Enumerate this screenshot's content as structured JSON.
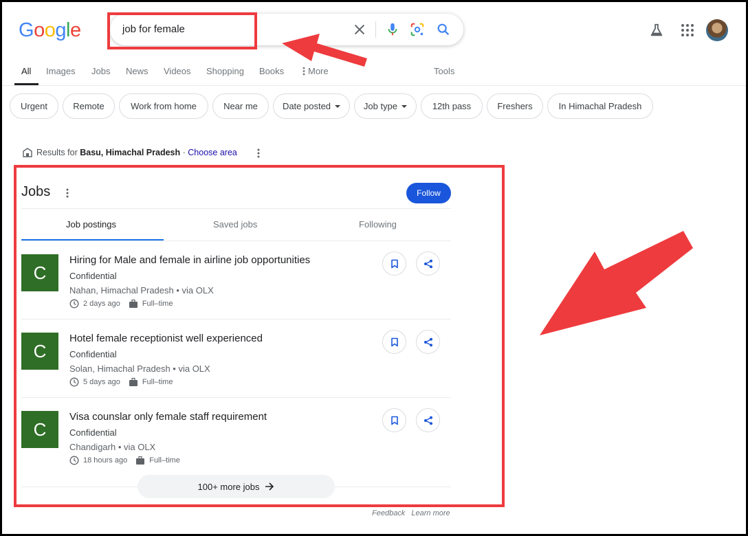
{
  "logo": "Google",
  "search": {
    "query": "job for female"
  },
  "nav": {
    "tabs": [
      "All",
      "Images",
      "Jobs",
      "News",
      "Videos",
      "Shopping",
      "Books",
      "More",
      "Tools"
    ]
  },
  "chips": [
    "Urgent",
    "Remote",
    "Work from home",
    "Near me",
    "Date posted",
    "Job type",
    "12th pass",
    "Freshers",
    "In Himachal Pradesh"
  ],
  "location": {
    "prefix": "Results for",
    "place": "Basu, Himachal Pradesh",
    "separator": "·",
    "choose_area": "Choose area"
  },
  "jobs": {
    "title": "Jobs",
    "follow_label": "Follow",
    "tabs": [
      "Job postings",
      "Saved jobs",
      "Following"
    ],
    "listings": [
      {
        "logo_letter": "C",
        "title": "Hiring for Male and female in airline job opportunities",
        "company": "Confidential",
        "place": "Nahan, Himachal Pradesh • via OLX",
        "posted": "2 days ago",
        "type": "Full–time"
      },
      {
        "logo_letter": "C",
        "title": "Hotel female receptionist well experienced",
        "company": "Confidential",
        "place": "Solan, Himachal Pradesh • via OLX",
        "posted": "5 days ago",
        "type": "Full–time"
      },
      {
        "logo_letter": "C",
        "title": "Visa counslar only female staff requirement",
        "company": "Confidential",
        "place": "Chandigarh • via OLX",
        "posted": "18 hours ago",
        "type": "Full–time"
      }
    ],
    "more_label": "100+ more jobs"
  },
  "footer": {
    "feedback": "Feedback",
    "learn_more": "Learn more"
  },
  "colors": {
    "highlight": "#ee3b3e",
    "follow_button": "#1a56db",
    "company_logo": "#2f6e26",
    "tab_underline": "#1a73e8"
  }
}
